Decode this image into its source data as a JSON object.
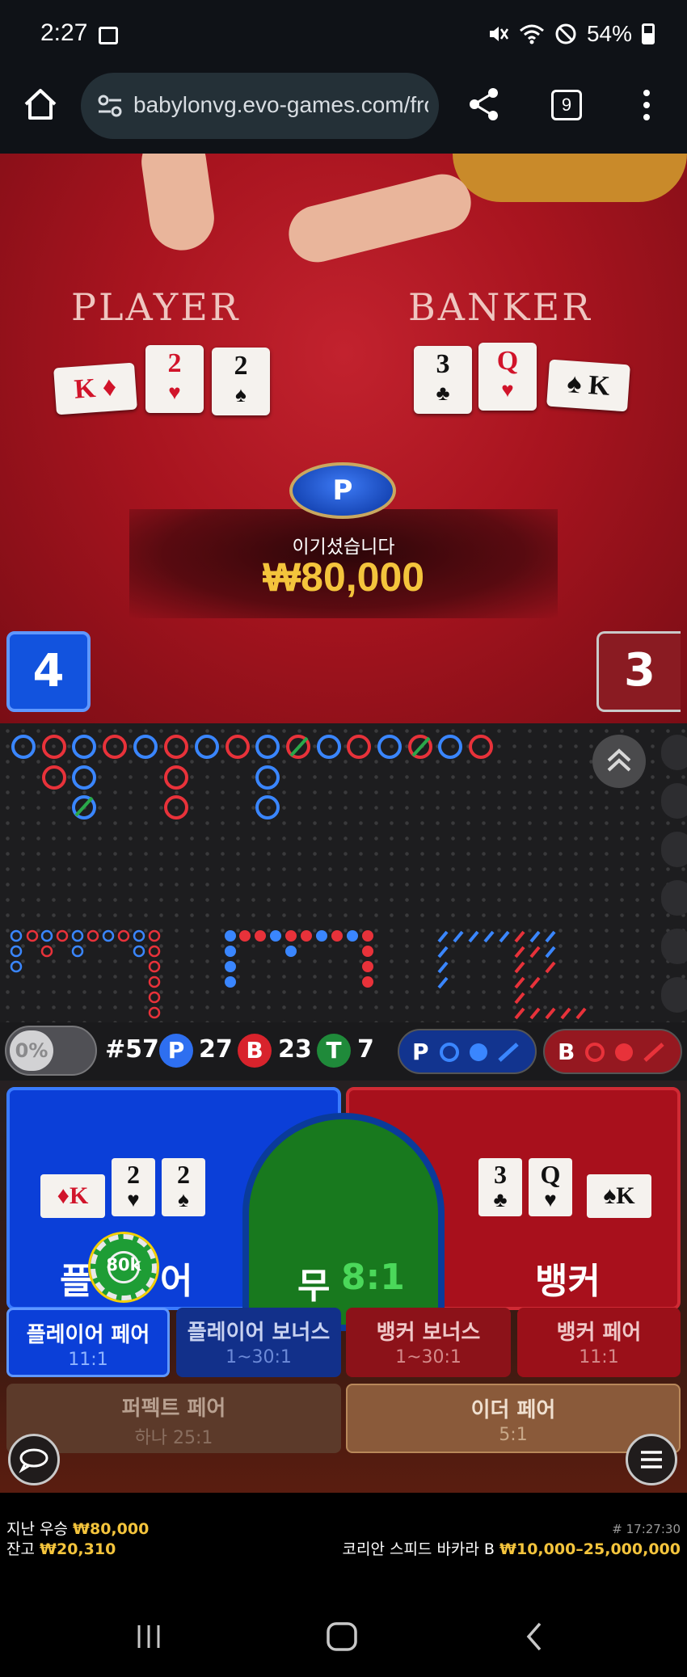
{
  "status_bar": {
    "time": "2:27",
    "battery": "54%"
  },
  "browser": {
    "url": "babylonvg.evo-games.com/fro",
    "tab_count": "9"
  },
  "video": {
    "player_label": "PLAYER",
    "banker_label": "BANKER",
    "player_cards": [
      {
        "rank": "K",
        "suit": "♦",
        "color": "red"
      },
      {
        "rank": "2",
        "suit": "♥",
        "color": "red"
      },
      {
        "rank": "2",
        "suit": "♠",
        "color": "black"
      }
    ],
    "banker_cards": [
      {
        "rank": "3",
        "suit": "♣",
        "color": "black"
      },
      {
        "rank": "Q",
        "suit": "♥",
        "color": "red"
      },
      {
        "rank": "K",
        "suit": "♠",
        "color": "black"
      }
    ],
    "winner_badge": "P",
    "win_message": "이기셨습니다",
    "win_amount": "₩80,000",
    "player_score": "4",
    "banker_score": "3"
  },
  "stats": {
    "percent": "0%",
    "round": "#57",
    "player_label": "P",
    "player_count": "27",
    "banker_label": "B",
    "banker_count": "23",
    "tie_label": "T",
    "tie_count": "7",
    "predict_player": "P",
    "predict_banker": "B"
  },
  "betting": {
    "player": "플레이어",
    "player_visible_left": "플",
    "player_visible_right": "어",
    "banker": "뱅커",
    "tie": "무",
    "tie_odds": "8:1",
    "chip_value": "80k",
    "side_bets": [
      {
        "name": "플레이어 페어",
        "odds": "11:1"
      },
      {
        "name": "플레이어 보너스",
        "odds": "1~30:1"
      },
      {
        "name": "뱅커 보너스",
        "odds": "1~30:1"
      },
      {
        "name": "뱅커 페어",
        "odds": "11:1"
      }
    ],
    "perfect_pair": {
      "name": "퍼펙트 페어",
      "odds": "하나 25:1"
    },
    "either_pair": {
      "name": "이더 페어",
      "odds": "5:1"
    }
  },
  "footer": {
    "last_win_label": "지난 우승",
    "last_win_value": "₩80,000",
    "balance_label": "잔고",
    "balance_value": "₩20,310",
    "round_id": "# 17:27:30",
    "table_name": "코리안 스피드 바카라 B",
    "table_limits": "₩10,000–25,000,000"
  },
  "colors": {
    "player_blue": "#0b3fd8",
    "banker_red": "#a8101c",
    "tie_green": "#18791e",
    "gold": "#f4c43c"
  }
}
